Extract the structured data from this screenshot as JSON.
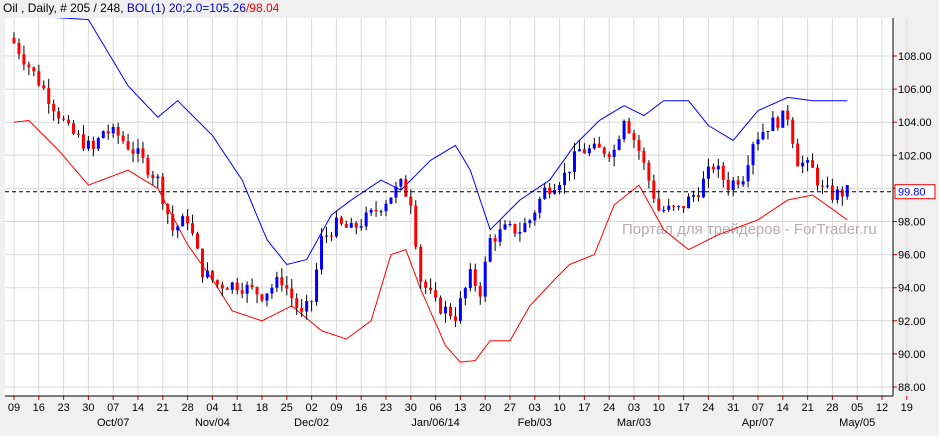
{
  "header": {
    "symbol": "Oil",
    "period": "Daily",
    "bar_info": "# 205 / 248",
    "indicator": "BOL(1) 20;2.0=105.26",
    "indicator_low": "/98.04"
  },
  "watermark": "Портал для трейдеров - ForTrader.ru",
  "colors": {
    "up": "#0000ff",
    "down": "#ff0000",
    "upper_band": "#0000ff",
    "lower_band": "#ff0000",
    "grid": "#d8d8d8"
  },
  "chart_data": {
    "type": "candlestick",
    "title": "Oil , Daily",
    "ylim": [
      87.5,
      110
    ],
    "y_ticks": [
      "108.00",
      "106.00",
      "104.00",
      "102.00",
      "100.00",
      "98.00",
      "96.00",
      "94.00",
      "92.00",
      "90.00",
      "88.00"
    ],
    "current_price": "99.80",
    "x_ticks": [
      "09",
      "16",
      "23",
      "30",
      "07",
      "14",
      "21",
      "28",
      "04",
      "11",
      "18",
      "25",
      "02",
      "09",
      "16",
      "23",
      "30",
      "06",
      "13",
      "20",
      "27",
      "03",
      "10",
      "17",
      "24",
      "03",
      "10",
      "17",
      "24",
      "31",
      "07",
      "14",
      "21",
      "28",
      "05",
      "12",
      "19"
    ],
    "x_month_labels": [
      {
        "label": "Oct/07",
        "tick": 4
      },
      {
        "label": "Nov/04",
        "tick": 8
      },
      {
        "label": "Dec/02",
        "tick": 12
      },
      {
        "label": "Jan/06/14",
        "tick": 17
      },
      {
        "label": "Feb/03",
        "tick": 21
      },
      {
        "label": "Mar/03",
        "tick": 25
      },
      {
        "label": "Apr/07",
        "tick": 30
      },
      {
        "label": "May/05",
        "tick": 34
      }
    ],
    "bars_per_tick": 5,
    "close_path": [
      [
        0,
        108.8
      ],
      [
        6,
        106
      ],
      [
        11,
        103.5
      ],
      [
        16,
        102.3
      ],
      [
        18,
        103.5
      ],
      [
        21,
        103.2
      ],
      [
        25,
        102
      ],
      [
        29,
        100.5
      ],
      [
        32,
        97.5
      ],
      [
        35,
        98.2
      ],
      [
        38,
        95
      ],
      [
        41,
        94.2
      ],
      [
        45,
        94.2
      ],
      [
        50,
        93.6
      ],
      [
        54,
        94.5
      ],
      [
        58,
        92.3
      ],
      [
        60,
        93.2
      ],
      [
        62,
        96.9
      ],
      [
        65,
        97.8
      ],
      [
        68,
        97.5
      ],
      [
        72,
        98.4
      ],
      [
        75,
        99.3
      ],
      [
        78,
        100.2
      ],
      [
        80,
        99.3
      ],
      [
        82,
        94.5
      ],
      [
        85,
        93
      ],
      [
        89,
        92.3
      ],
      [
        92,
        94.7
      ],
      [
        94,
        93.8
      ],
      [
        96,
        96.9
      ],
      [
        99,
        97.5
      ],
      [
        102,
        97.5
      ],
      [
        104,
        98.1
      ],
      [
        107,
        99.9
      ],
      [
        111,
        100.8
      ],
      [
        114,
        102.3
      ],
      [
        118,
        102.3
      ],
      [
        121,
        102.3
      ],
      [
        123,
        104.4
      ],
      [
        126,
        102.3
      ],
      [
        129,
        99.6
      ],
      [
        130,
        98.7
      ],
      [
        134,
        98.7
      ],
      [
        138,
        99.9
      ],
      [
        141,
        101.4
      ],
      [
        144,
        100.2
      ],
      [
        147,
        100.8
      ],
      [
        149,
        102.9
      ],
      [
        152,
        103.8
      ],
      [
        156,
        104.4
      ],
      [
        158,
        101.7
      ],
      [
        161,
        101.1
      ],
      [
        163,
        99.9
      ],
      [
        165,
        99.6
      ],
      [
        168,
        99.8
      ]
    ],
    "upper_band": [
      [
        -1,
        110.5
      ],
      [
        15,
        110.2
      ],
      [
        23,
        106.2
      ],
      [
        29,
        104.3
      ],
      [
        33,
        105.3
      ],
      [
        40,
        103.2
      ],
      [
        46,
        100.5
      ],
      [
        51,
        96.9
      ],
      [
        55,
        95.4
      ],
      [
        59,
        95.7
      ],
      [
        64,
        98.4
      ],
      [
        68,
        99.3
      ],
      [
        74,
        100.5
      ],
      [
        78,
        99.9
      ],
      [
        84,
        101.7
      ],
      [
        89,
        102.6
      ],
      [
        92,
        101.1
      ],
      [
        96,
        97.5
      ],
      [
        102,
        99.3
      ],
      [
        108,
        100.5
      ],
      [
        113,
        102.6
      ],
      [
        118,
        104.1
      ],
      [
        123,
        105
      ],
      [
        127,
        104.4
      ],
      [
        131,
        105.3
      ],
      [
        136,
        105.3
      ],
      [
        140,
        103.8
      ],
      [
        145,
        102.9
      ],
      [
        150,
        104.7
      ],
      [
        156,
        105.5
      ],
      [
        161,
        105.3
      ],
      [
        168,
        105.3
      ]
    ],
    "lower_band": [
      [
        0,
        104
      ],
      [
        3,
        104.1
      ],
      [
        9,
        102.3
      ],
      [
        15,
        100.2
      ],
      [
        23,
        101.1
      ],
      [
        29,
        100
      ],
      [
        35,
        96.6
      ],
      [
        40,
        94.5
      ],
      [
        44,
        92.6
      ],
      [
        50,
        92
      ],
      [
        56,
        92.9
      ],
      [
        62,
        91.4
      ],
      [
        67,
        90.9
      ],
      [
        72,
        92
      ],
      [
        76,
        96
      ],
      [
        79,
        96.3
      ],
      [
        82,
        93.9
      ],
      [
        87,
        90.5
      ],
      [
        90,
        89.5
      ],
      [
        93,
        89.6
      ],
      [
        96,
        90.8
      ],
      [
        100,
        90.8
      ],
      [
        104,
        92.9
      ],
      [
        109,
        94.5
      ],
      [
        112,
        95.4
      ],
      [
        117,
        96
      ],
      [
        121,
        99
      ],
      [
        126,
        100.2
      ],
      [
        131,
        97.5
      ],
      [
        136,
        96.3
      ],
      [
        142,
        97.2
      ],
      [
        150,
        98.1
      ],
      [
        156,
        99.3
      ],
      [
        161,
        99.6
      ],
      [
        168,
        98.1
      ]
    ]
  }
}
